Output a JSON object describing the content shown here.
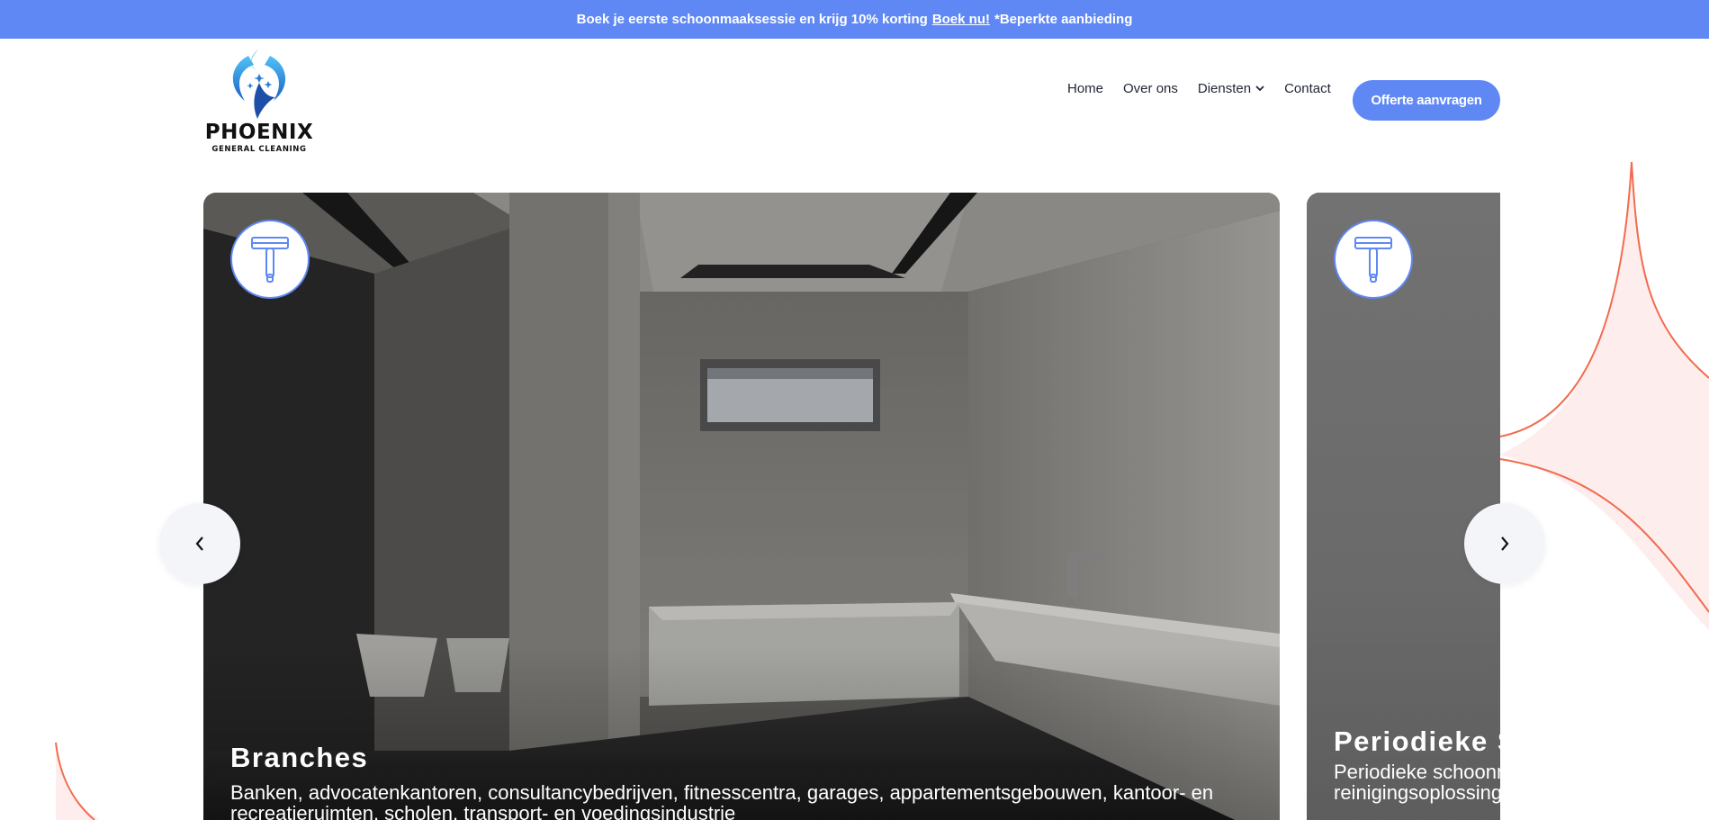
{
  "announcement": {
    "text": "Boek je eerste schoonmaaksessie en krijg 10% korting",
    "link": "Boek nu!",
    "suffix": "*Beperkte aanbieding"
  },
  "logo": {
    "name": "PHOENIX",
    "subtitle": "GENERAL CLEANING"
  },
  "nav": {
    "items": [
      {
        "label": "Home"
      },
      {
        "label": "Over ons"
      },
      {
        "label": "Diensten",
        "has_dropdown": true
      },
      {
        "label": "Contact"
      }
    ],
    "cta_label": "Offerte aanvragen"
  },
  "carousel": {
    "cards": [
      {
        "icon": "squeegee-icon",
        "title": "Branches",
        "text": "Banken, advocatenkantoren, consultancybedrijven, fitnesscentra, garages, appartementsgebouwen, kantoor- en recreatieruimten, scholen, transport- en voedingsindustrie"
      },
      {
        "icon": "squeegee-icon",
        "title": "Periodieke S",
        "text": "Periodieke schoonm jaar ervaring in per reinigingsoplossing"
      }
    ],
    "prev_icon": "chevron-left-icon",
    "next_icon": "chevron-right-icon"
  },
  "colors": {
    "brand": "#5f88f5",
    "deco_stroke": "#f26b4f",
    "deco_fill": "#fdeeed"
  }
}
